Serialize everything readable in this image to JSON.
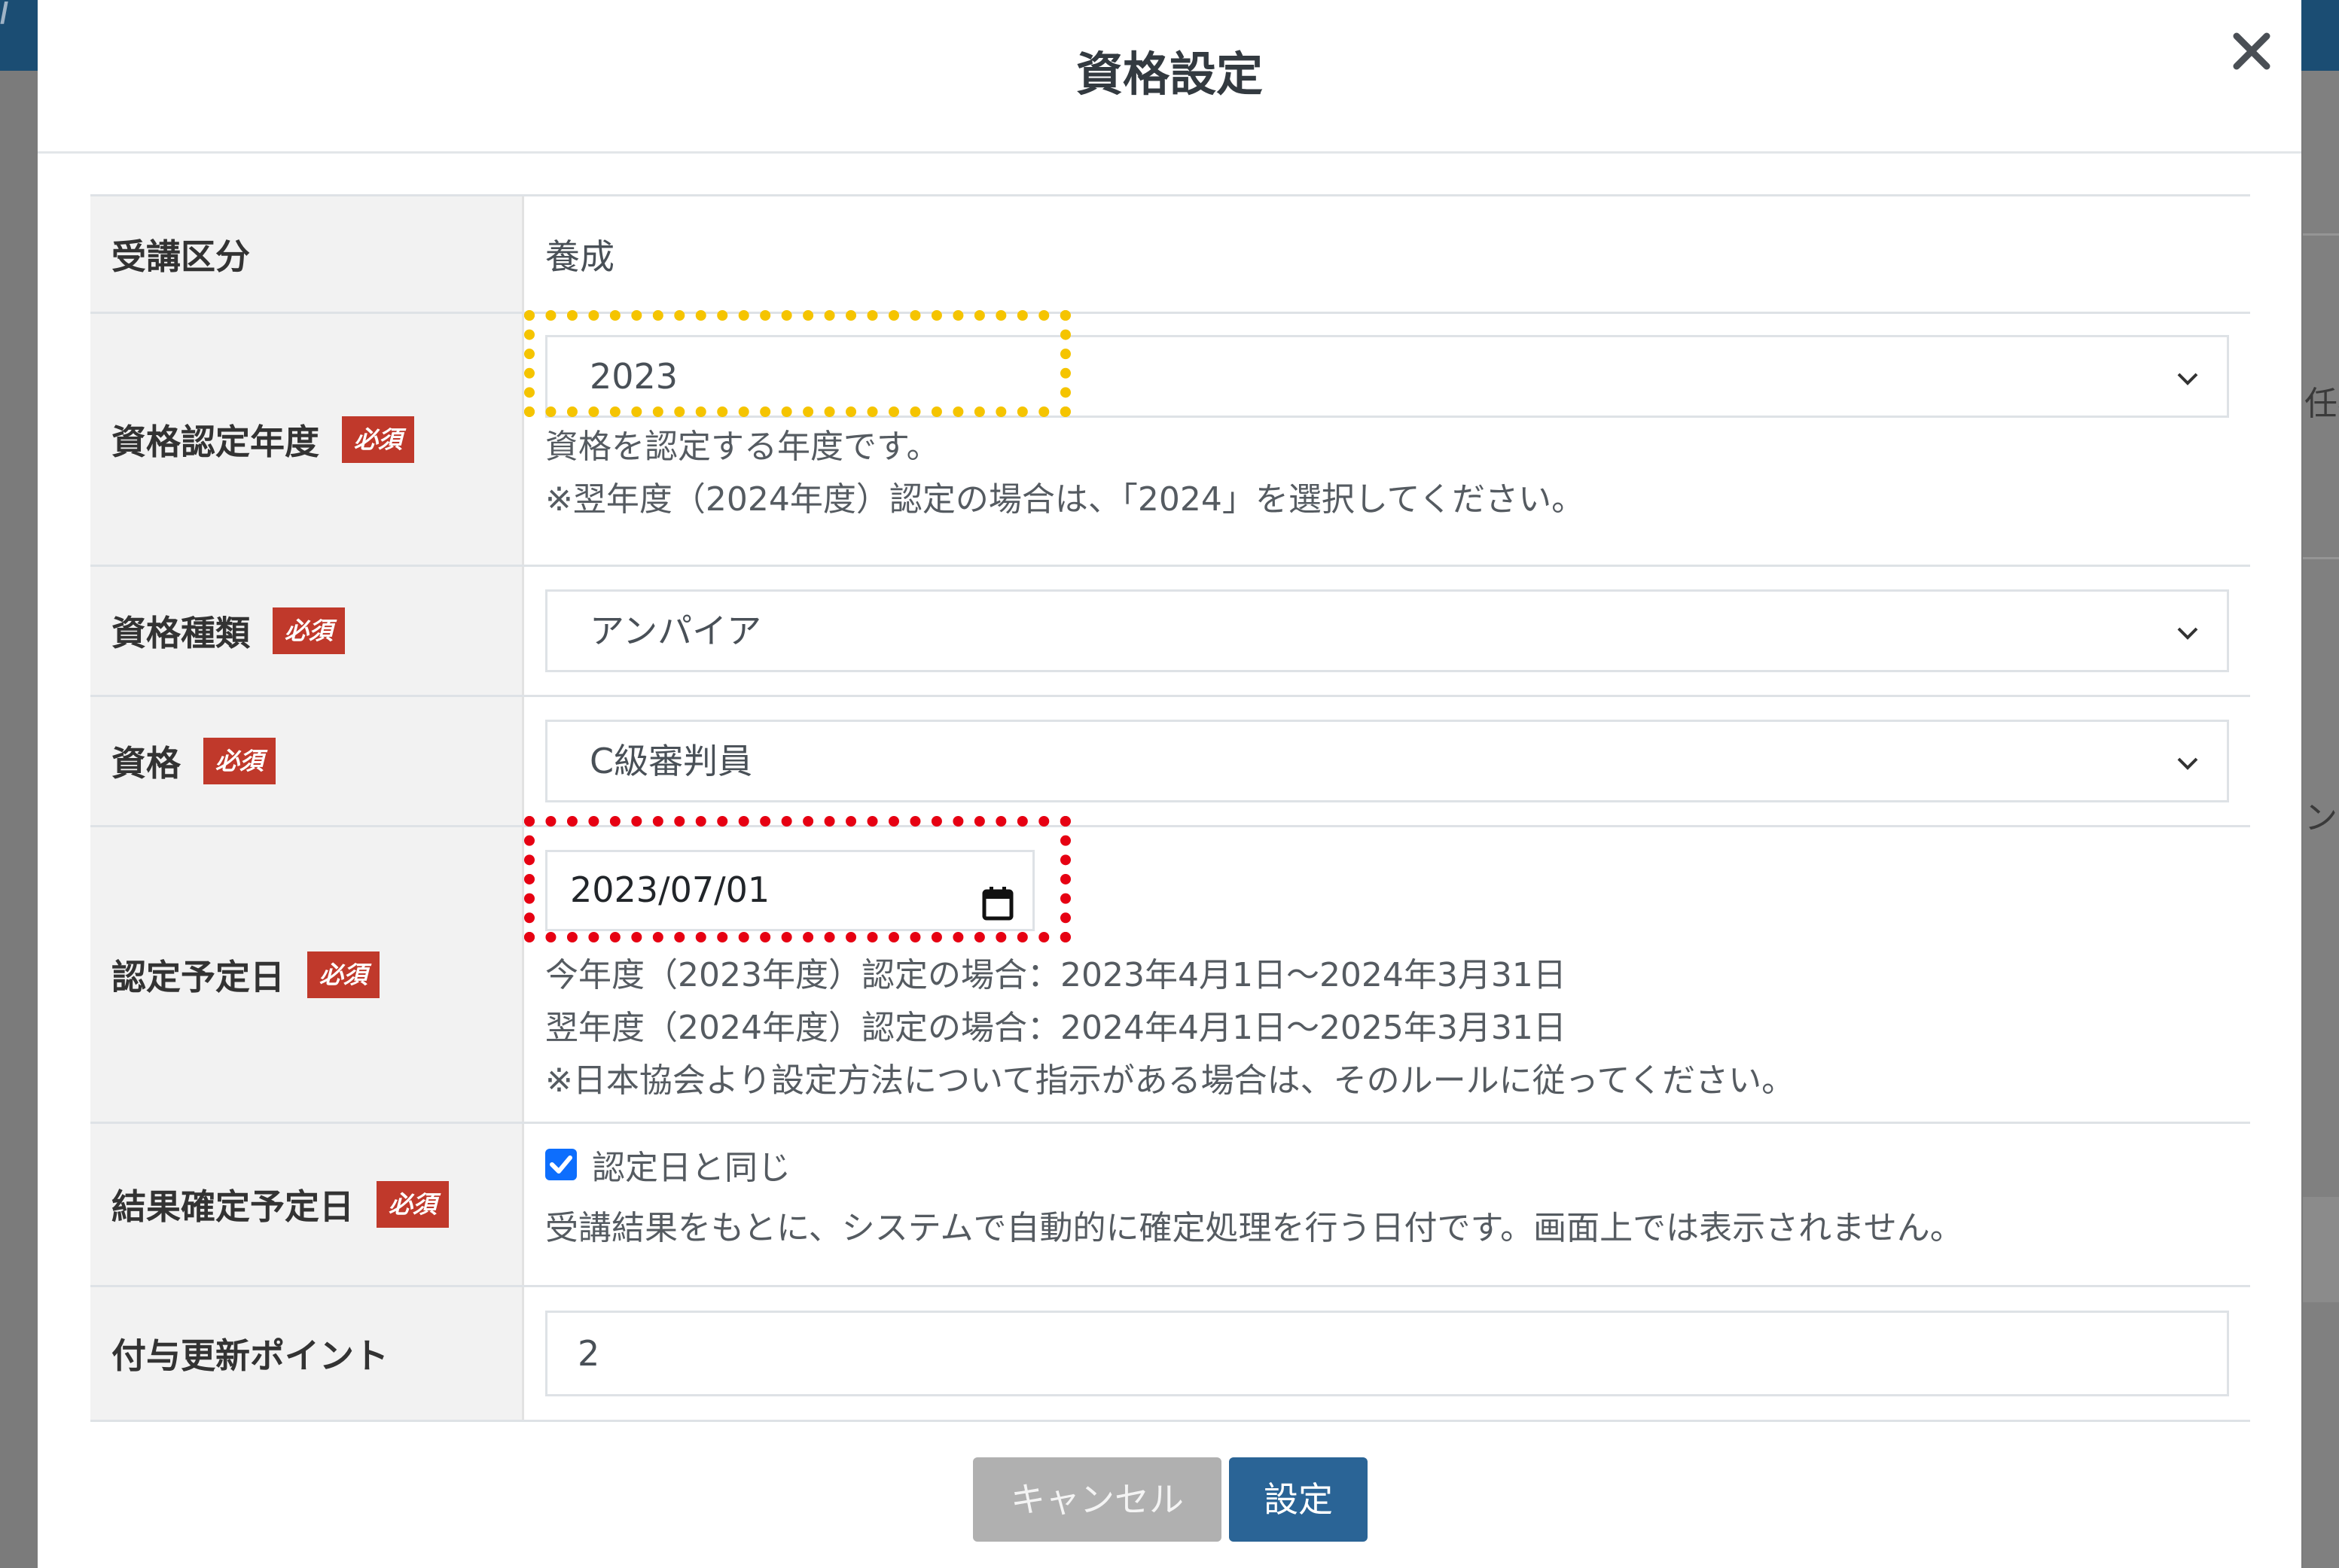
{
  "background": {
    "logo_fragment": "/",
    "right_text_1": "任者",
    "right_text_2": "ント"
  },
  "dialog": {
    "title": "資格設定",
    "close_symbol": "✕"
  },
  "form": {
    "course_type": {
      "label": "受講区分",
      "value": "養成"
    },
    "cert_year": {
      "label": "資格認定年度",
      "required": "必須",
      "selected": "2023",
      "help_1": "資格を認定する年度です。",
      "help_2": "※翌年度（2024年度）認定の場合は、「2024」を選択してください。"
    },
    "cert_type": {
      "label": "資格種類",
      "required": "必須",
      "selected": "アンパイア"
    },
    "qualification": {
      "label": "資格",
      "required": "必須",
      "selected": "C級審判員"
    },
    "cert_date": {
      "label": "認定予定日",
      "required": "必須",
      "value": "2023/07/01",
      "help_1": "今年度（2023年度）認定の場合：2023年4月1日～2024年3月31日",
      "help_2": "翌年度（2024年度）認定の場合：2024年4月1日～2025年3月31日",
      "help_3": "※日本協会より設定方法について指示がある場合は、そのルールに従ってください。"
    },
    "result_date": {
      "label": "結果確定予定日",
      "required": "必須",
      "checkbox_label": "認定日と同じ",
      "checked": true,
      "help": "受講結果をもとに、システムで自動的に確定処理を行う日付です。画面上では表示されません。"
    },
    "points": {
      "label": "付与更新ポイント",
      "value": "2"
    }
  },
  "buttons": {
    "cancel": "キャンセル",
    "submit": "設定"
  },
  "colors": {
    "required_badge": "#c0392b",
    "submit_button": "#2a6496",
    "cancel_button": "#b0b0b0",
    "highlight_yellow": "#f5c400",
    "highlight_red": "#e60012",
    "checkbox": "#0d6efd"
  }
}
